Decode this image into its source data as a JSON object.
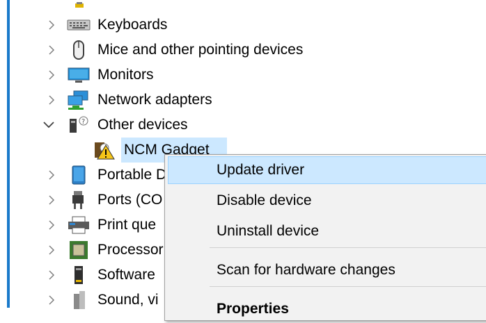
{
  "tree": {
    "items": [
      {
        "label": "Keyboards",
        "icon": "keyboard-icon",
        "expanded": false
      },
      {
        "label": "Mice and other pointing devices",
        "icon": "mouse-icon",
        "expanded": false
      },
      {
        "label": "Monitors",
        "icon": "monitor-icon",
        "expanded": false
      },
      {
        "label": "Network adapters",
        "icon": "network-adapter-icon",
        "expanded": false
      },
      {
        "label": "Other devices",
        "icon": "unknown-device-icon",
        "expanded": true
      },
      {
        "label": "NCM Gadget",
        "icon": "warning-device-icon",
        "selected": true
      },
      {
        "label": "Portable D",
        "icon": "portable-device-icon",
        "expanded": false
      },
      {
        "label": "Ports (CO",
        "icon": "port-icon",
        "expanded": false
      },
      {
        "label": "Print que",
        "icon": "printer-icon",
        "expanded": false
      },
      {
        "label": "Processor",
        "icon": "processor-icon",
        "expanded": false
      },
      {
        "label": "Software",
        "icon": "software-device-icon",
        "expanded": false
      },
      {
        "label": "Sound, vi",
        "icon": "sound-icon",
        "expanded": false
      }
    ]
  },
  "context_menu": {
    "items": [
      {
        "label": "Update driver",
        "highlighted": true
      },
      {
        "label": "Disable device"
      },
      {
        "label": "Uninstall device"
      },
      {
        "label": "Scan for hardware changes"
      },
      {
        "label": "Properties",
        "bold": true
      }
    ]
  },
  "colors": {
    "accent": "#1979ca",
    "highlight": "#cce8ff",
    "menu_bg": "#f2f2f2"
  }
}
